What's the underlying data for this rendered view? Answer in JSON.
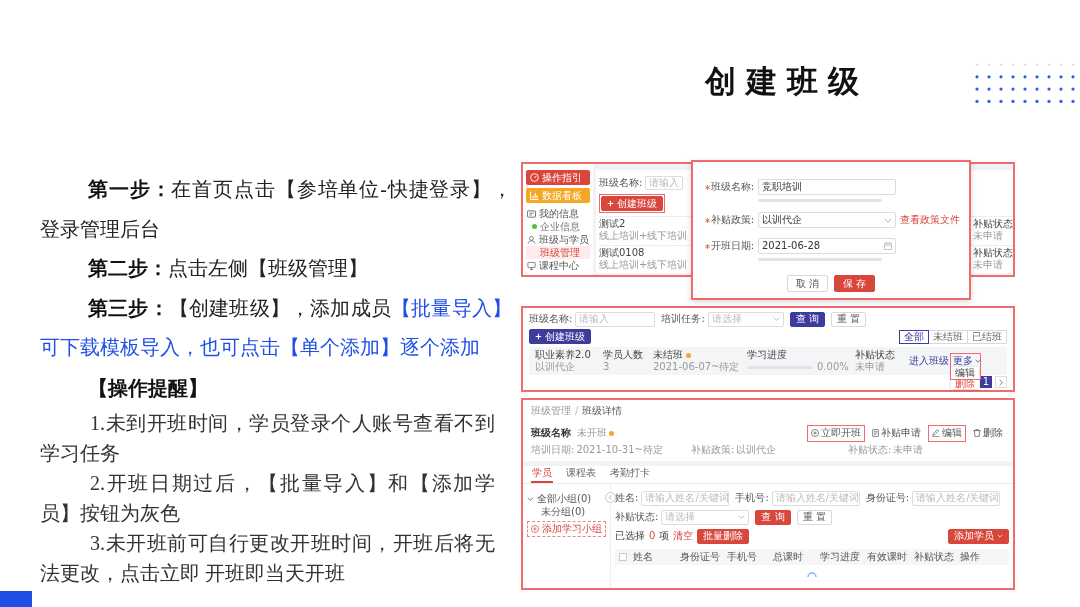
{
  "title": "创建班级",
  "steps": [
    {
      "segments": [
        {
          "kind": "bold",
          "text": "第一步："
        },
        {
          "kind": "plain",
          "text": "在首页点击【参培单位-快捷登录】，登录管理后台"
        }
      ]
    },
    {
      "segments": [
        {
          "kind": "bold",
          "text": "第二步："
        },
        {
          "kind": "plain",
          "text": "点击左侧【班级管理】"
        }
      ]
    },
    {
      "segments": [
        {
          "kind": "bold",
          "text": "第三步："
        },
        {
          "kind": "plain",
          "text": "【创建班级】，添加成员"
        },
        {
          "kind": "highlight",
          "text": "【批量导入】可下载模板导入，也可点击【单个添加】逐个添加"
        }
      ]
    }
  ],
  "reminder": {
    "heading": "【操作提醒】",
    "items": [
      "1.未到开班时间，学员登录个人账号查看不到学习任务",
      "2.开班日期过后，【批量导入】和【添加学员】按钮为灰色",
      "3.未开班前可自行更改开班时间，开班后将无法更改，点击立即 开班即当天开班"
    ]
  },
  "class_list_page": {
    "sidebar": [
      {
        "kind": "button",
        "label": "操作指引",
        "color": "#d8463c"
      },
      {
        "kind": "button",
        "label": "数据看板",
        "color": "#f5a623"
      },
      {
        "kind": "section",
        "label": "我的信息"
      },
      {
        "kind": "subitem",
        "label": "企业信息",
        "selected": false,
        "color": "#4fc13b"
      },
      {
        "kind": "section",
        "label": "班级与学员"
      },
      {
        "kind": "subitem",
        "label": "班级管理",
        "selected": true
      },
      {
        "kind": "section",
        "label": "课程中心"
      }
    ],
    "filter": {
      "label": "班级名称:",
      "placeholder": "请输入"
    },
    "create_button": {
      "label": "创建班级",
      "highlighted": true
    },
    "rows": [
      {
        "name": "测试2",
        "mode": "线上培训+线下培训",
        "status_label": "补贴状态",
        "status": "未申请"
      },
      {
        "name": "测试0108",
        "mode": "线上培训+线下培训",
        "status_label": "补贴状态",
        "status": "未申请"
      }
    ]
  },
  "create_dialog": {
    "fields": [
      {
        "kind": "text",
        "label": "班级名称:",
        "required": true,
        "value": "竞职培训",
        "hint_shown": true
      },
      {
        "kind": "select",
        "label": "补贴政策:",
        "required": true,
        "value": "以训代企",
        "link": "查看政策文件"
      },
      {
        "kind": "date",
        "label": "开班日期:",
        "required": true,
        "value": "2021-06-28",
        "hint_shown": true
      }
    ],
    "buttons": [
      {
        "kind": "secondary",
        "label": "取 消"
      },
      {
        "kind": "primary",
        "label": "保 存"
      }
    ]
  },
  "class_list_table": {
    "filters": [
      {
        "kind": "input",
        "label": "班级名称:",
        "placeholder": "请输入"
      },
      {
        "kind": "select",
        "label": "培训任务:",
        "placeholder": "请选择"
      }
    ],
    "buttons": [
      {
        "kind": "primary",
        "label": "查 询"
      },
      {
        "kind": "secondary",
        "label": "重 置"
      }
    ],
    "create_button": "创建班级",
    "views": [
      {
        "label": "全部",
        "selected": true
      },
      {
        "label": "未结班",
        "selected": false
      },
      {
        "label": "已结班",
        "selected": false
      }
    ],
    "row": {
      "name": "职业素养2.0",
      "policy": "以训代企",
      "count_label": "学员人数",
      "count": "3",
      "status": {
        "label": "未结班",
        "color": "#f5a623"
      },
      "dates": "2021-06-07~待定",
      "progress_label": "学习进度",
      "progress": {
        "level": 0,
        "reading": "0.00%"
      },
      "subsidy_label": "补贴状态",
      "subsidy": "未申请",
      "enter_link": "进入班级",
      "more": "更多",
      "more_highlighted": true,
      "menu": [
        {
          "kind": "normal",
          "label": "编辑"
        },
        {
          "kind": "danger",
          "label": "删除"
        }
      ]
    },
    "pages": [
      {
        "label": "1",
        "selected": true
      }
    ]
  },
  "class_detail": {
    "breadcrumb": {
      "items": [
        "班级管理",
        "班级详情"
      ],
      "separator": "/"
    },
    "name": "班级名称",
    "status": {
      "label": "未开班",
      "color": "#f5a623"
    },
    "actions": [
      {
        "kind": "start",
        "label": "立即开班",
        "highlighted": true
      },
      {
        "kind": "subsidy",
        "label": "补贴申请",
        "highlighted": false
      },
      {
        "kind": "edit",
        "label": "编辑",
        "highlighted": true
      },
      {
        "kind": "delete",
        "label": "删除",
        "highlighted": false
      }
    ],
    "info": [
      {
        "label": "培训日期:",
        "value": "2021-10-31~待定"
      },
      {
        "label": "补贴政策:",
        "value": "以训代企"
      },
      {
        "label": "补贴状态:",
        "value": "未申请"
      }
    ],
    "tabs": [
      {
        "label": "学员",
        "selected": true
      },
      {
        "label": "课程表",
        "selected": false
      },
      {
        "label": "考勤打卡",
        "selected": false
      }
    ],
    "groups": [
      {
        "label": "全部小组(0)",
        "expanded": true,
        "children": [
          {
            "label": "未分组(0)"
          }
        ]
      }
    ],
    "add_group_button": "添加学习小组",
    "filters": [
      {
        "kind": "input",
        "label": "姓名:",
        "placeholder": "请输入姓名/关键词"
      },
      {
        "kind": "input",
        "label": "手机号:",
        "placeholder": "请输入姓名/关键词"
      },
      {
        "kind": "input",
        "label": "身份证号:",
        "placeholder": "请输入姓名/关键词"
      },
      {
        "kind": "select",
        "label": "补贴状态:",
        "placeholder": "请选择"
      }
    ],
    "buttons": [
      {
        "kind": "primary",
        "label": "查 询"
      },
      {
        "kind": "secondary",
        "label": "重 置"
      }
    ],
    "selection": {
      "prefix": "已选择",
      "count": "0",
      "suffix": "项",
      "clear_link": "清空",
      "bulk_delete_button": "批量删除"
    },
    "add_student_button": "添加学员",
    "columns": [
      "姓名",
      "身份证号",
      "手机号",
      "总课时",
      "学习进度",
      "有效课时",
      "补贴状态",
      "操作"
    ],
    "select_all_checked": false,
    "loading": true
  }
}
